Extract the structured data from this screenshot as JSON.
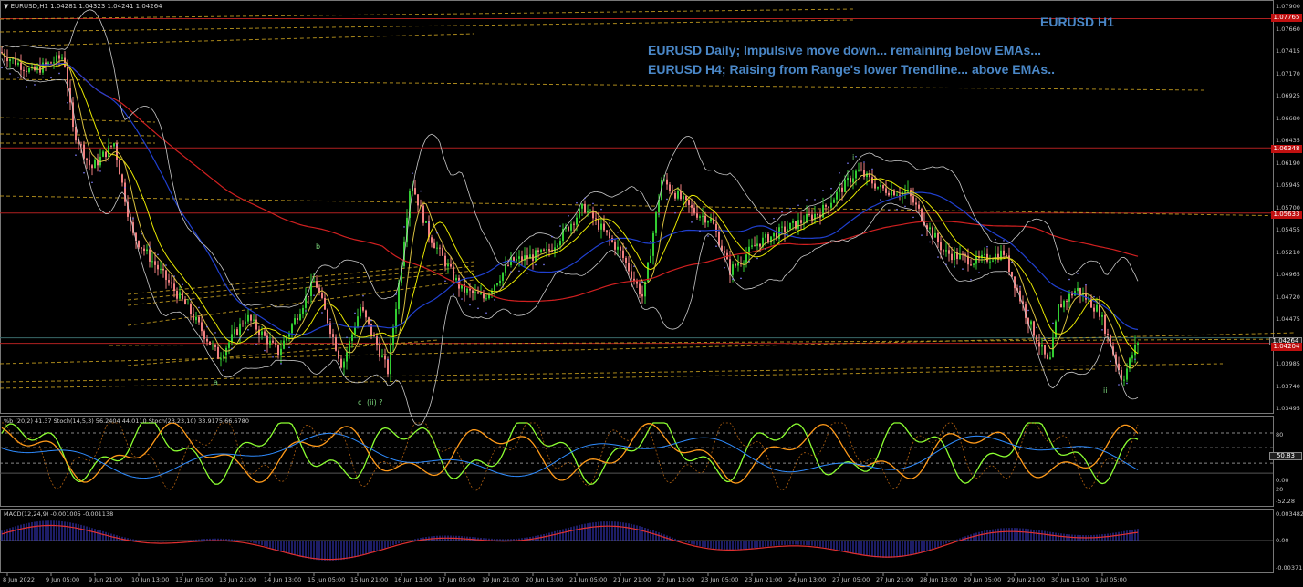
{
  "header": {
    "title": "EURUSD,H1  1.04281 1.04323 1.04241 1.04264"
  },
  "annotations": {
    "symbol_tf": "EURUSD H1",
    "daily": "EURUSD Daily; Impulsive move down... remaining below EMAs...",
    "h4": "EURUSD H4; Raising from Range's lower Trendline... above EMAs.."
  },
  "waves": {
    "a": "a",
    "b": "b",
    "c": "c",
    "ii_q": "(ii) ?",
    "i": "i",
    "ii": "ii"
  },
  "price_axis": {
    "labels": [
      "1.07900",
      "1.07660",
      "1.07415",
      "1.07170",
      "1.06925",
      "1.06680",
      "1.06435",
      "1.06190",
      "1.05945",
      "1.05700",
      "1.05455",
      "1.05210",
      "1.04965",
      "1.04720",
      "1.04475",
      "1.04230",
      "1.03985",
      "1.03740",
      "1.03495"
    ],
    "tags": {
      "top_line": "1.07765",
      "line2": "1.06348",
      "line3": "1.05633",
      "bid": "1.04264",
      "line4": "1.04204"
    }
  },
  "indicators": {
    "stoch_title": "%b (20,2) 41.37  Stoch(14,5,3) 56.2404 44.0110  Stoch(23,23,10) 33.9175 66.6780",
    "stoch_levels": [
      "80",
      "50.83",
      "0.00",
      "20",
      "-52.28"
    ],
    "macd_title": "MACD(12,24,9) -0.001005 -0.001138",
    "macd_levels": [
      "0.003482",
      "0.00",
      "-0.00371"
    ]
  },
  "time_axis": [
    "8 Jun 2022",
    "9 Jun 05:00",
    "9 Jun 21:00",
    "10 Jun 13:00",
    "13 Jun 05:00",
    "13 Jun 21:00",
    "14 Jun 13:00",
    "15 Jun 05:00",
    "15 Jun 21:00",
    "16 Jun 13:00",
    "17 Jun 05:00",
    "19 Jun 21:00",
    "20 Jun 13:00",
    "21 Jun 05:00",
    "21 Jun 21:00",
    "22 Jun 13:00",
    "23 Jun 05:00",
    "23 Jun 21:00",
    "24 Jun 13:00",
    "27 Jun 05:00",
    "27 Jun 21:00",
    "28 Jun 13:00",
    "29 Jun 05:00",
    "29 Jun 21:00",
    "30 Jun 13:00",
    "1 Jul 05:00"
  ],
  "colors": {
    "bull": "#32cd32",
    "bear": "#f08080",
    "ema_red": "#d02020",
    "ema_blue": "#2040d0",
    "ema_yellow": "#e8e800",
    "bands": "#c8c8c8",
    "hlines": "#c8a020",
    "annotation": "#4a87c7",
    "tag": "#c01010"
  }
}
